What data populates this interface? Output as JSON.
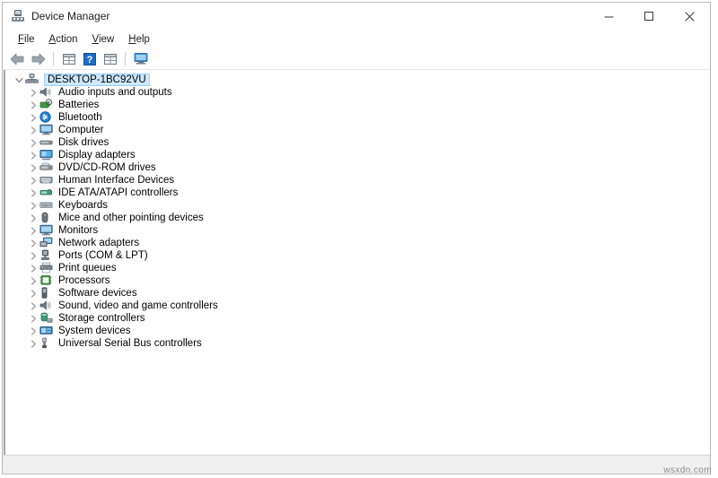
{
  "window": {
    "title": "Device Manager",
    "icon": "device-manager-icon",
    "controls": {
      "minimize": "–",
      "maximize": "□",
      "close": "✕"
    }
  },
  "menubar": {
    "items": [
      {
        "label": "File",
        "accel": "F"
      },
      {
        "label": "Action",
        "accel": "A"
      },
      {
        "label": "View",
        "accel": "V"
      },
      {
        "label": "Help",
        "accel": "H"
      }
    ]
  },
  "toolbar": {
    "buttons": [
      {
        "name": "back-arrow-icon",
        "title": "Back"
      },
      {
        "name": "forward-arrow-icon",
        "title": "Forward"
      },
      {
        "name": "separator",
        "title": ""
      },
      {
        "name": "properties-grid-icon",
        "title": "Properties"
      },
      {
        "name": "help-question-icon",
        "title": "Help"
      },
      {
        "name": "update-driver-grid-icon",
        "title": "Update driver"
      },
      {
        "name": "separator",
        "title": ""
      },
      {
        "name": "scan-hardware-monitor-icon",
        "title": "Scan for hardware changes"
      }
    ]
  },
  "tree": {
    "root": {
      "label": "DESKTOP-1BC92VU",
      "icon": "computer-node-icon",
      "expanded": true,
      "selected": true
    },
    "children": [
      {
        "label": "Audio inputs and outputs",
        "icon": "speaker-icon"
      },
      {
        "label": "Batteries",
        "icon": "battery-icon"
      },
      {
        "label": "Bluetooth",
        "icon": "bluetooth-icon"
      },
      {
        "label": "Computer",
        "icon": "monitor-icon"
      },
      {
        "label": "Disk drives",
        "icon": "disk-drive-icon"
      },
      {
        "label": "Display adapters",
        "icon": "display-adapter-icon"
      },
      {
        "label": "DVD/CD-ROM drives",
        "icon": "dvd-drive-icon"
      },
      {
        "label": "Human Interface Devices",
        "icon": "hid-icon"
      },
      {
        "label": "IDE ATA/ATAPI controllers",
        "icon": "ide-controller-icon"
      },
      {
        "label": "Keyboards",
        "icon": "keyboard-icon"
      },
      {
        "label": "Mice and other pointing devices",
        "icon": "mouse-icon"
      },
      {
        "label": "Monitors",
        "icon": "monitor-icon"
      },
      {
        "label": "Network adapters",
        "icon": "network-adapter-icon"
      },
      {
        "label": "Ports (COM & LPT)",
        "icon": "port-icon"
      },
      {
        "label": "Print queues",
        "icon": "printer-icon"
      },
      {
        "label": "Processors",
        "icon": "processor-icon"
      },
      {
        "label": "Software devices",
        "icon": "software-device-icon"
      },
      {
        "label": "Sound, video and game controllers",
        "icon": "sound-controller-icon"
      },
      {
        "label": "Storage controllers",
        "icon": "storage-controller-icon"
      },
      {
        "label": "System devices",
        "icon": "system-device-icon"
      },
      {
        "label": "Universal Serial Bus controllers",
        "icon": "usb-controller-icon"
      }
    ]
  },
  "statusbar": {
    "text": ""
  },
  "watermark": {
    "text": "wsxdn.com"
  },
  "colors": {
    "selection_fill": "#cde8ff",
    "selection_border": "#99d1ff",
    "chevron": "#7a7a7a",
    "title_text": "#1b1b1b",
    "statusbar_bg": "#f0f0f0"
  }
}
